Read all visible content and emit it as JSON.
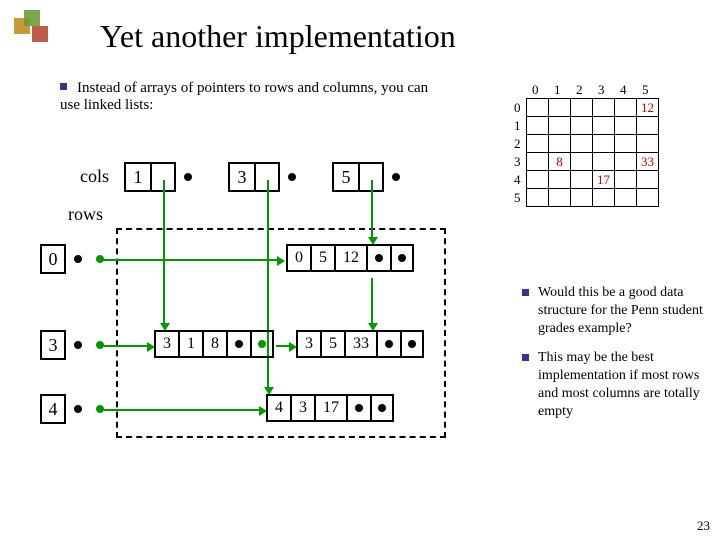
{
  "title": "Yet another implementation",
  "intro": "Instead of arrays of pointers to rows and columns, you can use linked lists:",
  "labels": {
    "cols": "cols",
    "rows": "rows"
  },
  "col_heads": [
    "1",
    "3",
    "5"
  ],
  "row_heads": [
    "0",
    "3",
    "4"
  ],
  "nodes": {
    "n318": [
      "3",
      "1",
      "8"
    ],
    "n0512": [
      "0",
      "5",
      "12"
    ],
    "n3533": [
      "3",
      "5",
      "33"
    ],
    "n4317": [
      "4",
      "3",
      "17"
    ]
  },
  "grid": {
    "col_labels": [
      "0",
      "1",
      "2",
      "3",
      "4",
      "5"
    ],
    "row_labels": [
      "0",
      "1",
      "2",
      "3",
      "4",
      "5"
    ],
    "cells": {
      "0,5": "12",
      "3,1": "8",
      "3,5": "33",
      "4,3": "17"
    }
  },
  "side": {
    "q": "Would this be a good data structure for the Penn student grades example?",
    "a": "This may be the best implementation if most rows and most columns are totally empty"
  },
  "page": "23",
  "chart_data": {
    "type": "table",
    "title": "sparse matrix",
    "categories_x": [
      "0",
      "1",
      "2",
      "3",
      "4",
      "5"
    ],
    "categories_y": [
      "0",
      "1",
      "2",
      "3",
      "4",
      "5"
    ],
    "entries": [
      {
        "row": 0,
        "col": 5,
        "value": 12
      },
      {
        "row": 3,
        "col": 1,
        "value": 8
      },
      {
        "row": 3,
        "col": 5,
        "value": 33
      },
      {
        "row": 4,
        "col": 3,
        "value": 17
      }
    ]
  }
}
